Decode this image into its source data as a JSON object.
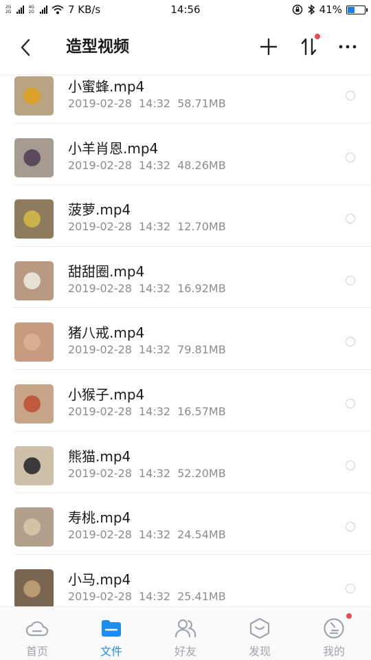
{
  "status_bar": {
    "net_top": "2G",
    "net_mid": "4G",
    "net_bot": "2G",
    "speed": "7 KB/s",
    "time": "14:56",
    "battery": "41%",
    "battery_level": 0.41
  },
  "header": {
    "title": "造型视频"
  },
  "files": [
    {
      "name": "小蜜蜂.mp4",
      "date": "2019-02-28",
      "time": "14:32",
      "size": "58.71MB",
      "thumb_color": "#b8a383",
      "accent": "#d9a12a"
    },
    {
      "name": "小羊肖恩.mp4",
      "date": "2019-02-28",
      "time": "14:32",
      "size": "48.26MB",
      "thumb_color": "#a69b90",
      "accent": "#5a4a5c"
    },
    {
      "name": "菠萝.mp4",
      "date": "2019-02-28",
      "time": "14:32",
      "size": "12.70MB",
      "thumb_color": "#8e7a5c",
      "accent": "#c9b34a"
    },
    {
      "name": "甜甜圈.mp4",
      "date": "2019-02-28",
      "time": "14:32",
      "size": "16.92MB",
      "thumb_color": "#b89a82",
      "accent": "#e9e0d4"
    },
    {
      "name": "猪八戒.mp4",
      "date": "2019-02-28",
      "time": "14:32",
      "size": "79.81MB",
      "thumb_color": "#c79b80",
      "accent": "#d8b090"
    },
    {
      "name": "小猴子.mp4",
      "date": "2019-02-28",
      "time": "14:32",
      "size": "16.57MB",
      "thumb_color": "#c6a488",
      "accent": "#c05a3c"
    },
    {
      "name": "熊猫.mp4",
      "date": "2019-02-28",
      "time": "14:32",
      "size": "52.20MB",
      "thumb_color": "#cdbfa8",
      "accent": "#3a3a3a"
    },
    {
      "name": "寿桃.mp4",
      "date": "2019-02-28",
      "time": "14:32",
      "size": "24.54MB",
      "thumb_color": "#b3a08c",
      "accent": "#d6c3a6"
    },
    {
      "name": "小马.mp4",
      "date": "2019-02-28",
      "time": "14:32",
      "size": "25.41MB",
      "thumb_color": "#7a6650",
      "accent": "#b99a74"
    }
  ],
  "bottom_nav": [
    {
      "label": "首页",
      "icon": "cloud-icon",
      "active": false
    },
    {
      "label": "文件",
      "icon": "folder-icon",
      "active": true
    },
    {
      "label": "好友",
      "icon": "friends-icon",
      "active": false
    },
    {
      "label": "发现",
      "icon": "discover-icon",
      "active": false
    },
    {
      "label": "我的",
      "icon": "profile-icon",
      "active": false
    }
  ],
  "colors": {
    "accent": "#1e8df0",
    "badge": "#f2474b",
    "meta_text": "#8c8c8c"
  }
}
